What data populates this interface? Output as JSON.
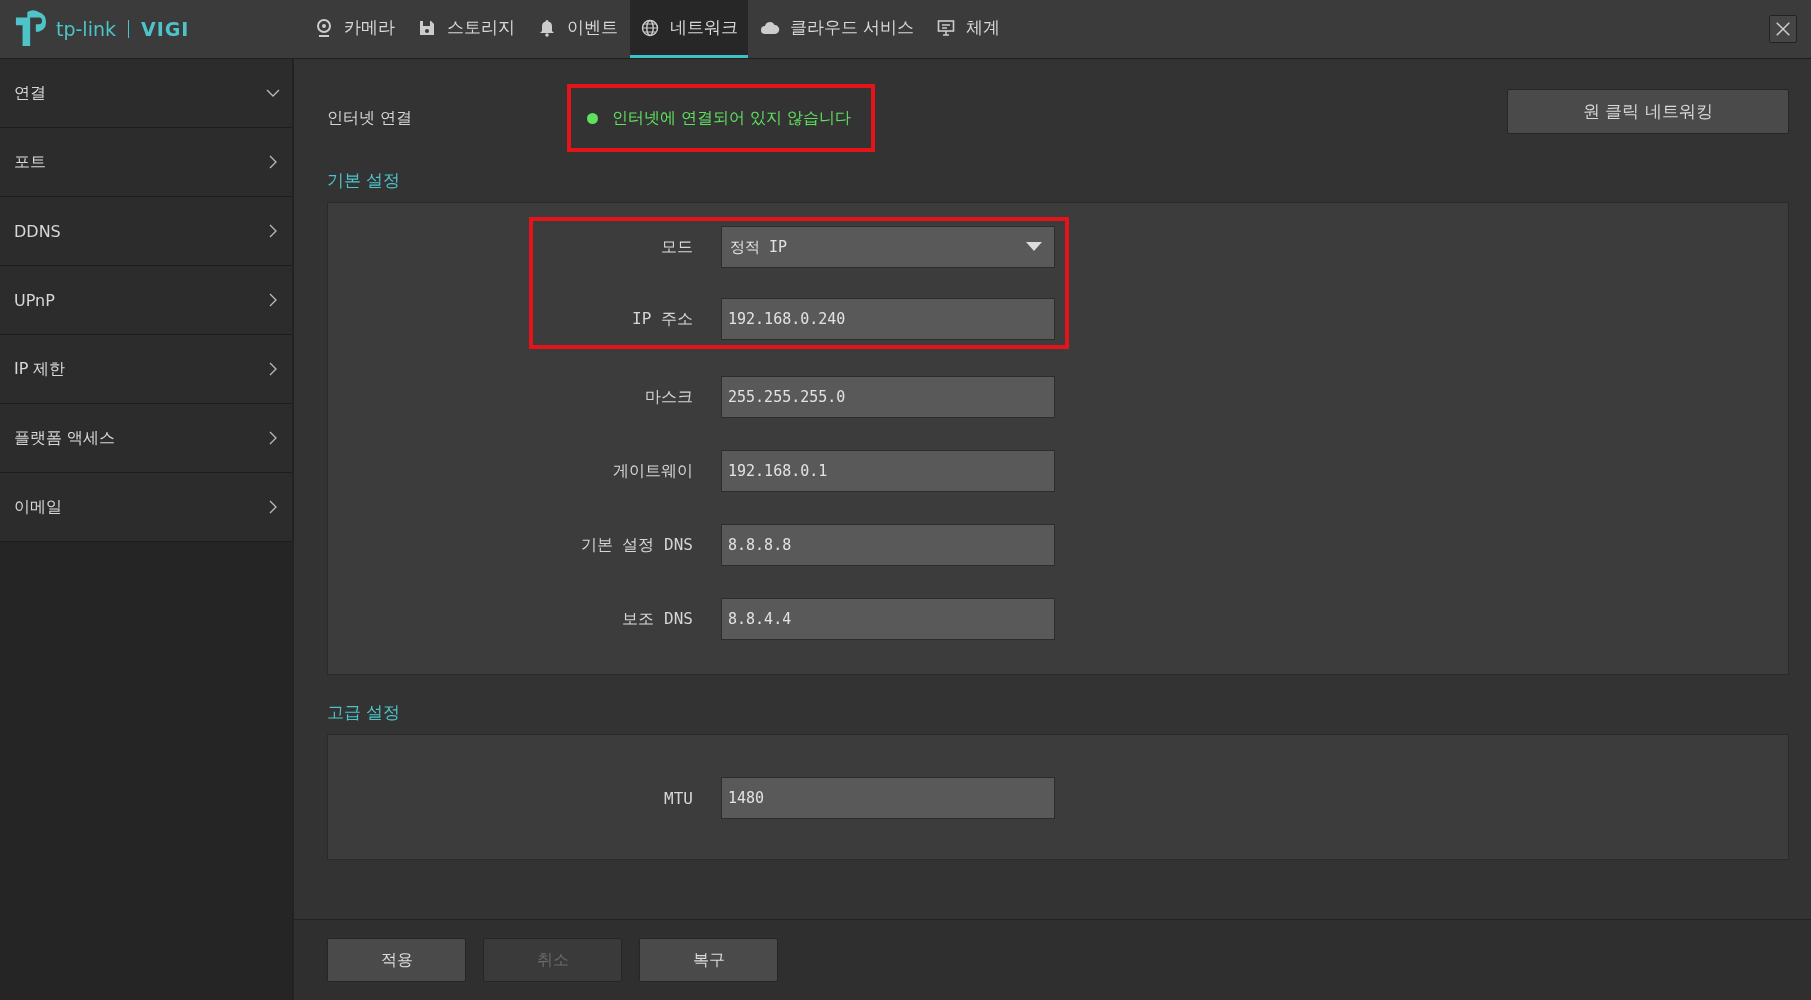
{
  "logo": {
    "brand": "tp-link",
    "product": "VIGI"
  },
  "nav": [
    {
      "label": "카메라",
      "selected": false
    },
    {
      "label": "스토리지",
      "selected": false
    },
    {
      "label": "이벤트",
      "selected": false
    },
    {
      "label": "네트워크",
      "selected": true
    },
    {
      "label": "클라우드 서비스",
      "selected": false
    },
    {
      "label": "체계",
      "selected": false
    }
  ],
  "sidebar": {
    "items": [
      {
        "label": "연결",
        "expanded": true
      },
      {
        "label": "포트",
        "expanded": false
      },
      {
        "label": "DDNS",
        "expanded": false
      },
      {
        "label": "UPnP",
        "expanded": false
      },
      {
        "label": "IP 제한",
        "expanded": false
      },
      {
        "label": "플랫폼 액세스",
        "expanded": false
      },
      {
        "label": "이메일",
        "expanded": false
      }
    ]
  },
  "internet": {
    "label": "인터넷 연결",
    "status": "인터넷에 연결되어 있지 않습니다",
    "color": "#5fe05f",
    "highlighted": true
  },
  "one_click_button": "원 클릭 네트워킹",
  "basic": {
    "title": "기본 설정",
    "fields": [
      {
        "label": "모드",
        "kind": "select",
        "value": "정적 IP",
        "highlighted": true
      },
      {
        "label": "IP 주소",
        "kind": "text",
        "value": "192.168.0.240",
        "highlighted": true
      },
      {
        "label": "마스크",
        "kind": "text",
        "value": "255.255.255.0",
        "highlighted": false
      },
      {
        "label": "게이트웨이",
        "kind": "text",
        "value": "192.168.0.1",
        "highlighted": false
      },
      {
        "label": "기본 설정 DNS",
        "kind": "text",
        "value": "8.8.8.8",
        "highlighted": false
      },
      {
        "label": "보조 DNS",
        "kind": "text",
        "value": "8.8.4.4",
        "highlighted": false
      }
    ]
  },
  "advanced": {
    "title": "고급 설정",
    "fields": [
      {
        "label": "MTU",
        "kind": "text",
        "value": "1480",
        "highlighted": false
      }
    ]
  },
  "buttons": [
    {
      "label": "적용",
      "disabled": false
    },
    {
      "label": "취소",
      "disabled": true
    },
    {
      "label": "복구",
      "disabled": false
    }
  ]
}
